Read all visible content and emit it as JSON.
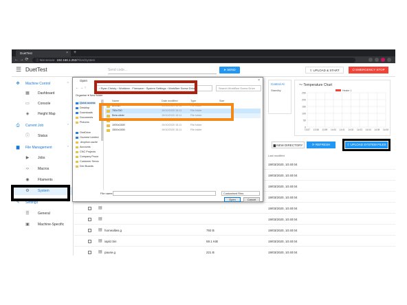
{
  "browser": {
    "tab_title": "DuetTest",
    "tab_close": "×",
    "new_tab": "+",
    "nav_icons": "← → ⟳",
    "not_secure": "ⓘ Not secure",
    "url_host": "192.168.1.253",
    "url_path": "/Files/System"
  },
  "appbar": {
    "title": "DuetTest",
    "gcode_placeholder": "Send code...",
    "send_label": "➤ SEND",
    "upload_start_label": "⇪ UPLOAD & START",
    "estop_label": "⏻ EMERGENCY STOP"
  },
  "sidebar": {
    "items": [
      {
        "label": "Machine Control",
        "icon": "gamepad-icon",
        "glyph": "✥",
        "type": "head",
        "chev": "⌃"
      },
      {
        "label": "Dashboard",
        "icon": "dashboard-icon",
        "glyph": "▦",
        "type": "item"
      },
      {
        "label": "Console",
        "icon": "console-icon",
        "glyph": "▭",
        "type": "item"
      },
      {
        "label": "Height Map",
        "icon": "heightmap-icon",
        "glyph": "◈",
        "type": "item"
      },
      {
        "label": "Current Job",
        "icon": "printer-icon",
        "glyph": "⎙",
        "type": "head",
        "chev": "⌃"
      },
      {
        "label": "Status",
        "icon": "info-icon",
        "glyph": "ⓘ",
        "type": "item"
      },
      {
        "label": "File Management",
        "icon": "folder-icon",
        "glyph": "▆",
        "type": "head",
        "chev": "⌃"
      },
      {
        "label": "Jobs",
        "icon": "play-icon",
        "glyph": "▶",
        "type": "item"
      },
      {
        "label": "Macros",
        "icon": "code-icon",
        "glyph": "‹›",
        "type": "item"
      },
      {
        "label": "Filaments",
        "icon": "filament-icon",
        "glyph": "◉",
        "type": "item"
      },
      {
        "label": "System",
        "icon": "gear-icon",
        "glyph": "⚙",
        "type": "item",
        "active": true
      },
      {
        "label": "Settings",
        "icon": "wrench-icon",
        "glyph": "✎",
        "type": "head",
        "chev": "⌃"
      },
      {
        "label": "General",
        "icon": "tune-icon",
        "glyph": "☰",
        "type": "item"
      },
      {
        "label": "Machine-Specific",
        "icon": "cpu-icon",
        "glyph": "▣",
        "type": "item"
      }
    ]
  },
  "panels": {
    "control_title": "Control Al",
    "control_sub": "Standby",
    "temp_chart_title": "〜 Temperature Chart",
    "heater_legend": "Heater 1"
  },
  "chart_data": {
    "type": "line",
    "title": "Temperature Chart",
    "series": [
      {
        "name": "Heater 1",
        "values": []
      }
    ],
    "y_ticks": [
      "250",
      "200",
      "150",
      "100",
      "50",
      "0"
    ],
    "x_ticks": [
      "13:57",
      "13:58",
      "13:59",
      "14:00",
      "14:01",
      "14:02",
      "14:03",
      "14:04",
      "14:05",
      "14:06"
    ],
    "ylim": [
      0,
      250
    ],
    "accent": "#f44336"
  },
  "toolbar": {
    "new_directory": "▆ NEW DIRECTORY",
    "refresh": "⟳ REFRESH",
    "upload_system_files": "⇪ UPLOAD SYSTEM FILES"
  },
  "table": {
    "headers": {
      "modified": "Last modified"
    },
    "rows": [
      {
        "name": "",
        "size": "",
        "date": "19/03/2020, 10:40:04"
      },
      {
        "name": "",
        "size": "",
        "date": "19/03/2020, 10:40:04"
      },
      {
        "name": "",
        "size": "",
        "date": "19/03/2020, 10:40:04"
      },
      {
        "name": "",
        "size": "",
        "date": "19/03/2020, 10:40:04"
      },
      {
        "name": "",
        "size": "",
        "date": "19/03/2020, 10:40:04"
      },
      {
        "name": "",
        "size": "",
        "date": "19/03/2020, 10:40:04"
      },
      {
        "name": "homeallws.g",
        "size": "793 B",
        "date": "19/03/2020, 10:40:04"
      },
      {
        "name": "iapiiz.bin",
        "size": "59.1 KiB",
        "date": "19/03/2020, 10:40:04"
      },
      {
        "name": "pause.g",
        "size": "221 B",
        "date": "19/03/2020, 10:40:04"
      },
      {
        "name": "resume.g",
        "size": "206 B",
        "date": "19/03/2020, 10:40:04"
      },
      {
        "name": "sleep.g",
        "size": "54 B",
        "date": "19/03/2020, 10:40:04"
      },
      {
        "name": "stop.g",
        "size": "66 B",
        "date": "19/03/2020, 10:40:04"
      }
    ]
  },
  "dialog": {
    "title": "Open",
    "close": "×",
    "nav_arrows": "← → ↑",
    "path": "› Ryan Christy › Workbee - Firmware › System Settings › WorkBee Screw Drive",
    "search_placeholder": "Search WorkBee Screw Drive",
    "organize": "Organise ▾   New folder",
    "tree": [
      {
        "label": "Quick access",
        "color": "blue"
      },
      {
        "label": "Desktop",
        "color": "blue"
      },
      {
        "label": "Downloads",
        "color": "blue"
      },
      {
        "label": "Documents",
        "color": "yellow"
      },
      {
        "label": "Pictures",
        "color": "yellow"
      },
      {
        "label": "OneDrive",
        "color": "blue"
      },
      {
        "label": "Ooznest Limited",
        "color": "blue"
      },
      {
        "label": ".dropbox.cache",
        "color": "yellow"
      },
      {
        "label": "Accounts",
        "color": "yellow"
      },
      {
        "label": "CNC Projects",
        "color": "yellow"
      },
      {
        "label": "Company Proce",
        "color": "yellow"
      },
      {
        "label": "Customer Servic",
        "color": "yellow"
      },
      {
        "label": "Dev Boards",
        "color": "yellow"
      }
    ],
    "list_headers": {
      "name": "Name",
      "date": "Date modified",
      "type": "Type",
      "size": "Size"
    },
    "files": [
      {
        "name": "Archive",
        "date": "19/10/2020 15:11",
        "type": "File folder"
      },
      {
        "name": "750x750",
        "date": "19/10/2020 15:11",
        "type": "File folder"
      },
      {
        "name": "Beta slider",
        "date": "19/10/2020 15:11",
        "type": "File folder"
      },
      {
        "name": "1000x1000",
        "date": "19/10/2020 15:11",
        "type": "File folder"
      },
      {
        "name": "1000x1500",
        "date": "19/10/2020 15:11",
        "type": "File folder"
      },
      {
        "name": "1500x1500",
        "date": "19/10/2020 15:11",
        "type": "File folder"
      }
    ],
    "file_name_label": "File name:",
    "filter": "Customised Files",
    "open_label": "Open",
    "cancel_label": "Cancel"
  }
}
